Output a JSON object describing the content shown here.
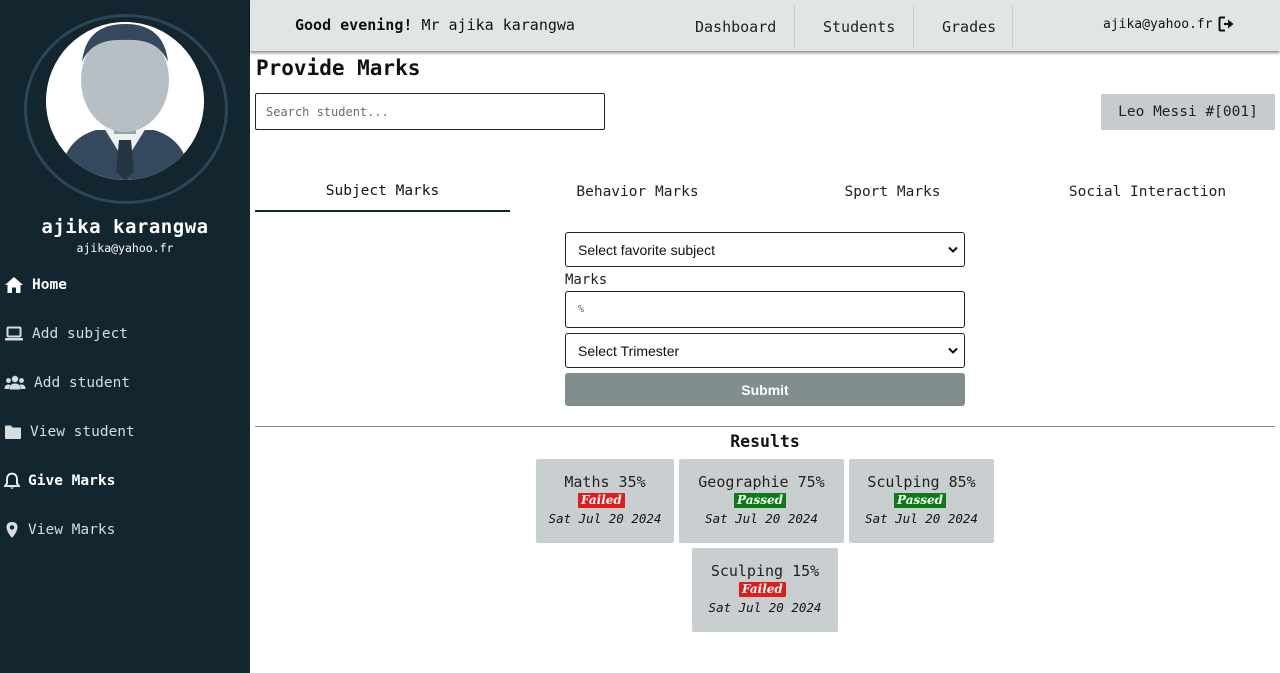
{
  "sidebar": {
    "profile": {
      "name": "ajika karangwa",
      "email": "ajika@yahoo.fr"
    },
    "items": [
      {
        "label": "Home",
        "icon": "home-icon"
      },
      {
        "label": "Add subject",
        "icon": "laptop-icon"
      },
      {
        "label": "Add student",
        "icon": "users-icon"
      },
      {
        "label": "View student",
        "icon": "folder-icon"
      },
      {
        "label": "Give Marks",
        "icon": "bell-icon"
      },
      {
        "label": "View Marks",
        "icon": "map-pin-icon"
      }
    ]
  },
  "header": {
    "greeting_strong": "Good evening!",
    "greeting_name": "Mr ajika karangwa",
    "nav": [
      "Dashboard",
      "Students",
      "Grades"
    ],
    "account_email": "ajika@yahoo.fr",
    "logout_icon": "logout-icon"
  },
  "main": {
    "title": "Provide Marks",
    "search_placeholder": "Search student...",
    "selected_student": "Leo Messi #[001]",
    "tabs": [
      "Subject Marks",
      "Behavior Marks",
      "Sport Marks",
      "Social Interaction"
    ],
    "active_tab": "Subject Marks",
    "form": {
      "subject_select": "Select favorite subject",
      "marks_label": "Marks",
      "marks_placeholder": "%",
      "trimester_select": "Select Trimester",
      "submit_label": "Submit"
    },
    "results": {
      "title": "Results",
      "cards": [
        {
          "subject": "Maths",
          "score": "35%",
          "status": "Failed",
          "date": "Sat Jul 20 2024"
        },
        {
          "subject": "Geographie",
          "score": "75%",
          "status": "Passed",
          "date": "Sat Jul 20 2024"
        },
        {
          "subject": "Sculping",
          "score": "85%",
          "status": "Passed",
          "date": "Sat Jul 20 2024"
        },
        {
          "subject": "Sculping",
          "score": "15%",
          "status": "Failed",
          "date": "Sat Jul 20 2024"
        }
      ]
    }
  },
  "colors": {
    "sidebar_bg": "#13262f",
    "header_bg": "#e2e5e6",
    "submit_bg": "#828e8d",
    "failed": "#e21b1b",
    "passed": "#0b7a12",
    "card_bg": "#c9ced1"
  }
}
